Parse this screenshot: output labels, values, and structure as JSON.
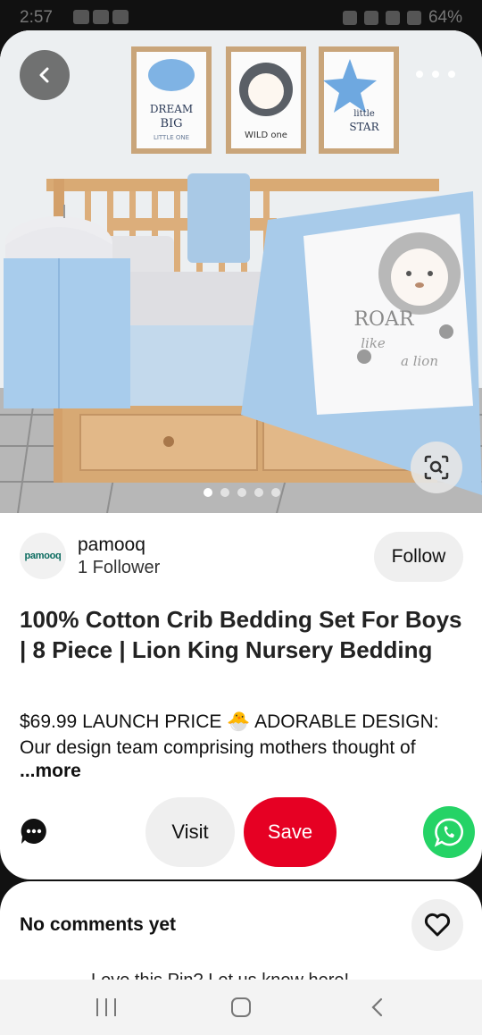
{
  "status_bar": {
    "time": "2:57",
    "battery": "64%"
  },
  "pin": {
    "hero_alt": "Baby crib bedding set with lion-themed quilt and wall art",
    "wall_art": [
      "DREAM BIG LITTLE ONE",
      "WILD one",
      "little STAR"
    ],
    "quilt_text": [
      "ROAR",
      "like",
      "a lion"
    ],
    "carousel": {
      "count": 5,
      "active": 1
    }
  },
  "creator": {
    "avatar_text": "pamooq",
    "name": "pamooq",
    "followers": "1 Follower",
    "follow_label": "Follow"
  },
  "title": "100% Cotton Crib Bedding Set For Boys | 8 Piece | Lion King Nursery Bedding",
  "description": "$69.99 LAUNCH PRICE 🐣 ADORABLE DESIGN: Our design team comprising mothers thought of",
  "more_label": "...more",
  "actions": {
    "visit_label": "Visit",
    "save_label": "Save"
  },
  "comments": {
    "title": "No comments yet",
    "peek_text": "Love this Pin? Let us know here!"
  },
  "colors": {
    "save_red": "#e60023",
    "whatsapp_green": "#25d366",
    "button_gray": "#efefef"
  },
  "icons": [
    "back-arrow-icon",
    "more-dots-icon",
    "visual-search-icon",
    "comment-icon",
    "whatsapp-icon",
    "heart-icon",
    "nav-recents-icon",
    "nav-home-icon",
    "nav-back-icon"
  ]
}
